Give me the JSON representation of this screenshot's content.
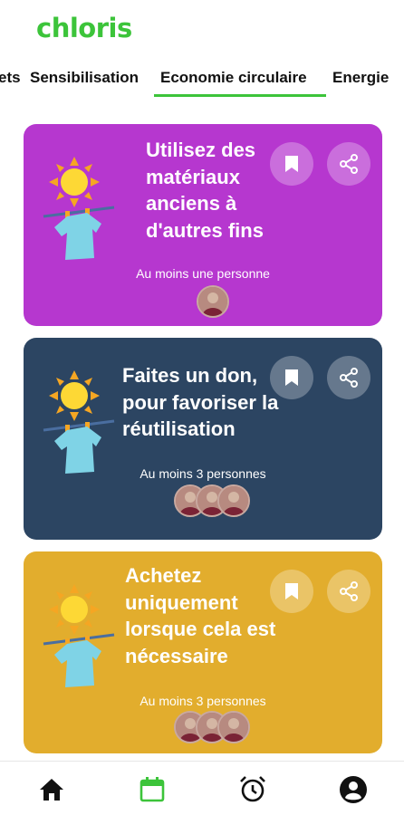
{
  "app": {
    "logo_text": "chloris"
  },
  "tabs": [
    {
      "label": "ets",
      "active": false
    },
    {
      "label": "Sensibilisation",
      "active": false
    },
    {
      "label": "Economie circulaire",
      "active": true
    },
    {
      "label": "Energie",
      "active": false
    }
  ],
  "cards": [
    {
      "title": "Utilisez des matériaux anciens à d'autres fins",
      "participants": "Au moins une personne",
      "avatar_count": 1,
      "color": "#b637cf"
    },
    {
      "title": "Faites un don, pour favoriser la réutilisation",
      "participants": "Au moins 3 personnes",
      "avatar_count": 3,
      "color": "#2c4562"
    },
    {
      "title": "Achetez uniquement lorsque cela est nécessaire",
      "participants": "Au moins 3 personnes",
      "avatar_count": 3,
      "color": "#e2ad2d"
    }
  ],
  "icons": {
    "save": "bookmark-icon",
    "share": "share-icon"
  },
  "nav": [
    {
      "icon": "home-icon",
      "active": false
    },
    {
      "icon": "calendar-icon",
      "active": true
    },
    {
      "icon": "alarm-clock-icon",
      "active": false
    },
    {
      "icon": "account-icon",
      "active": false
    }
  ],
  "colors": {
    "brand": "#3cc43a",
    "nav_active": "#3cc43a",
    "text": "#111111"
  }
}
